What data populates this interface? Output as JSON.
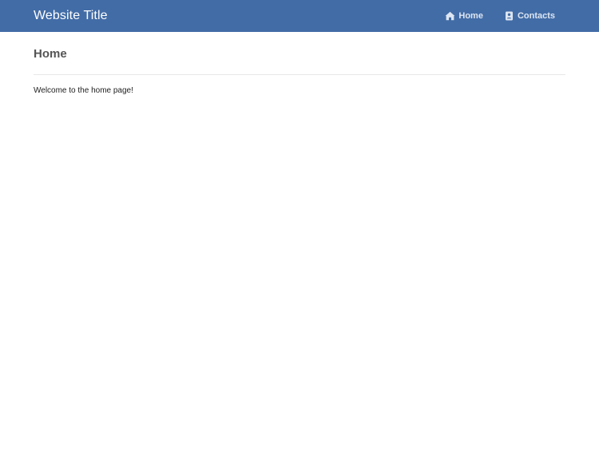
{
  "header": {
    "site_title": "Website Title",
    "background_color": "#426ca6",
    "nav": [
      {
        "label": "Home",
        "icon": "home-icon"
      },
      {
        "label": "Contacts",
        "icon": "contacts-icon"
      }
    ]
  },
  "main": {
    "page_title": "Home",
    "welcome_text": "Welcome to the home page!"
  }
}
